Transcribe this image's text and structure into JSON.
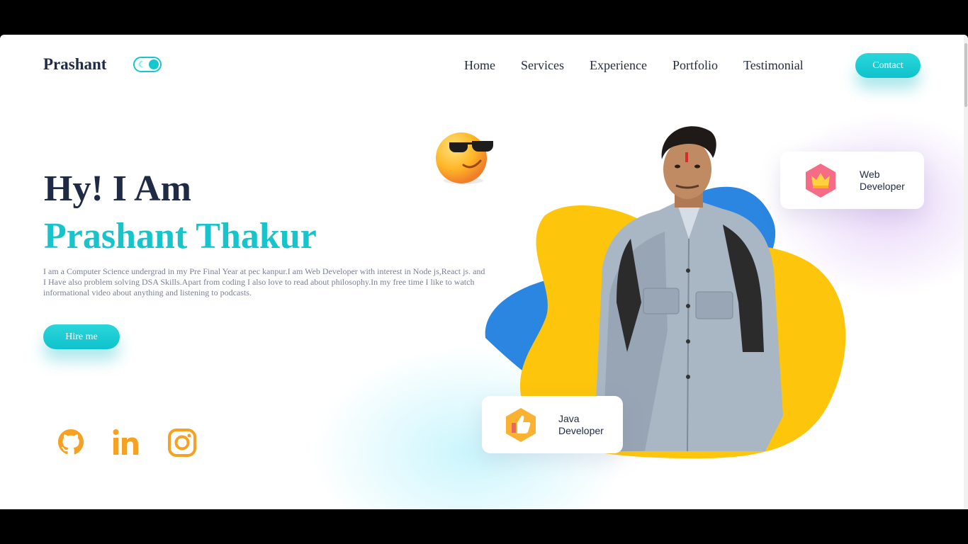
{
  "header": {
    "brand": "Prashant",
    "nav": [
      "Home",
      "Services",
      "Experience",
      "Portfolio",
      "Testimonial"
    ],
    "contact_label": "Contact"
  },
  "hero": {
    "greeting": "Hy! I Am",
    "name": "Prashant Thakur",
    "bio": "I am a Computer Science undergrad in my Pre Final Year at pec kanpur.I am Web Developer with interest in Node js,React js. and I Have also problem solving DSA Skills.Apart from coding I also love to read about philosophy.In my free time I like to watch informational video about anything and listening to podcasts.",
    "hire_label": "Hire me"
  },
  "social": [
    "github-icon",
    "linkedin-icon",
    "instagram-icon"
  ],
  "cards": {
    "web": "Web Developer",
    "java": "Java Developer"
  },
  "colors": {
    "accent": "#16c7cf",
    "dark": "#1f2a44",
    "social": "#f5a124",
    "blob_yellow": "#fdc50c",
    "blob_blue": "#2a86e0"
  }
}
